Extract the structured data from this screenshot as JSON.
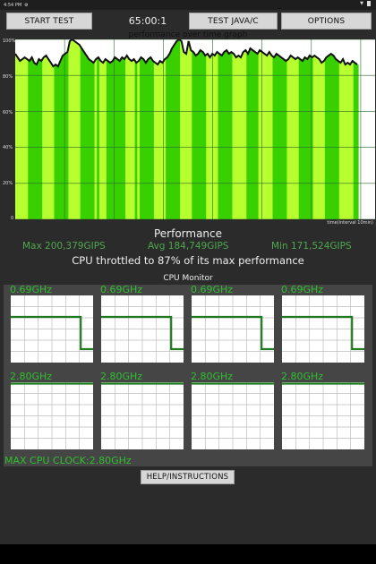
{
  "status_bar": {
    "time": "4:54 PM",
    "icons": [
      "settings-gear-icon",
      "wifi-icon",
      "battery-icon"
    ]
  },
  "toolbar": {
    "start_label": "START TEST",
    "timer": "65:00:1",
    "java_label": "TEST JAVA/C",
    "options_label": "OPTIONS"
  },
  "graph": {
    "title": "performance over time graph",
    "y_labels": [
      "100%",
      "80%",
      "60%",
      "40%",
      "20%",
      "0"
    ],
    "time_note": "time(interval 10min)",
    "colors": {
      "line": "#111111",
      "fill_light": "#b8ff30",
      "fill_dark": "#39d000",
      "grid": "#2a6a2a"
    }
  },
  "chart_data": {
    "type": "area",
    "title": "performance over time graph",
    "xlabel": "time(interval 10min)",
    "ylabel": "",
    "ylim": [
      0,
      100
    ],
    "values": [
      92,
      90,
      88,
      89,
      90,
      89,
      88,
      90,
      87,
      86,
      89,
      88,
      90,
      91,
      89,
      87,
      85,
      86,
      85,
      88,
      91,
      92,
      93,
      99,
      100,
      99,
      98,
      97,
      95,
      93,
      91,
      89,
      88,
      87,
      89,
      90,
      88,
      87,
      89,
      88,
      87,
      88,
      90,
      89,
      88,
      90,
      89,
      91,
      89,
      88,
      89,
      87,
      88,
      90,
      89,
      87,
      89,
      90,
      88,
      87,
      86,
      88,
      87,
      89,
      90,
      92,
      95,
      97,
      99,
      100,
      99,
      93,
      92,
      99,
      94,
      93,
      91,
      92,
      94,
      93,
      91,
      92,
      90,
      92,
      91,
      93,
      92,
      91,
      93,
      94,
      92,
      93,
      92,
      90,
      91,
      90,
      93,
      94,
      92,
      95,
      94,
      93,
      92,
      94,
      93,
      92,
      91,
      93,
      91,
      90,
      92,
      91,
      90,
      89,
      88,
      89,
      91,
      90,
      89,
      90,
      89,
      88,
      90,
      89,
      91,
      90,
      91,
      90,
      89,
      87,
      88,
      90,
      91,
      92,
      91,
      89,
      88,
      87,
      89,
      86,
      87,
      86,
      88,
      87,
      86
    ]
  },
  "performance": {
    "title": "Performance",
    "max": "Max 200,379GIPS",
    "avg": "Avg 184,749GIPS",
    "min": "Min 171,524GIPS",
    "throttle": "CPU throttled to 87% of its max performance"
  },
  "cpu_monitor": {
    "title": "CPU Monitor",
    "cores": [
      {
        "freq": "0.69GHz",
        "level_before": 0.7,
        "level_after": 0.2,
        "drop_at": 0.85
      },
      {
        "freq": "0.69GHz",
        "level_before": 0.7,
        "level_after": 0.2,
        "drop_at": 0.85
      },
      {
        "freq": "0.69GHz",
        "level_before": 0.7,
        "level_after": 0.2,
        "drop_at": 0.85
      },
      {
        "freq": "0.69GHz",
        "level_before": 0.7,
        "level_after": 0.2,
        "drop_at": 0.85
      },
      {
        "freq": "2.80GHz",
        "level_before": 1.0,
        "level_after": 1.0,
        "drop_at": 1.0
      },
      {
        "freq": "2.80GHz",
        "level_before": 1.0,
        "level_after": 1.0,
        "drop_at": 1.0
      },
      {
        "freq": "2.80GHz",
        "level_before": 1.0,
        "level_after": 1.0,
        "drop_at": 1.0
      },
      {
        "freq": "2.80GHz",
        "level_before": 1.0,
        "level_after": 1.0,
        "drop_at": 1.0
      }
    ],
    "max_clock": "MAX CPU CLOCK:2.80GHz"
  },
  "help_label": "HELP/INSTRUCTIONS"
}
